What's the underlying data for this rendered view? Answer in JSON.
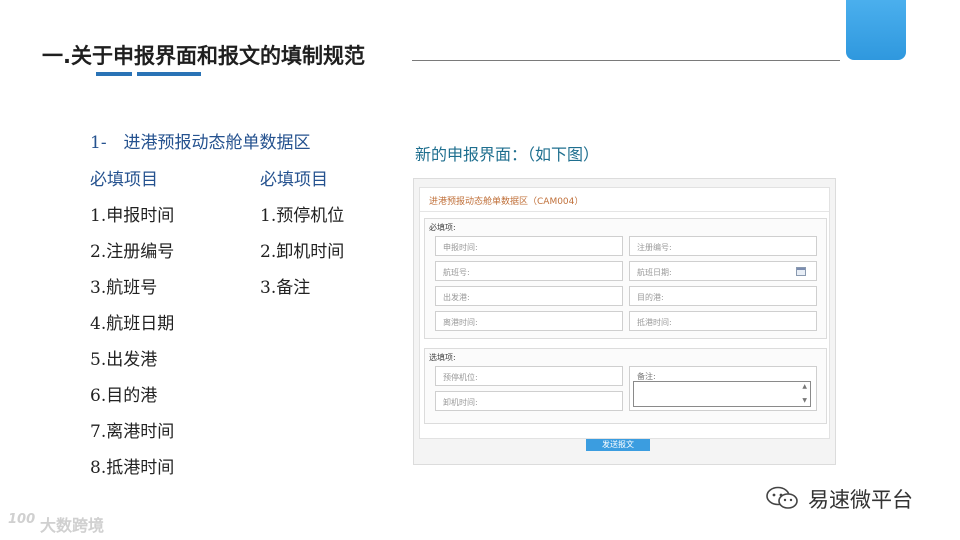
{
  "slide": {
    "title": "一.关于申报界面和报文的填制规范",
    "accent_color": "#2a73b6"
  },
  "left": {
    "section_heading": "1-　进港预报动态舱单数据区",
    "col1_heading": "必填项目",
    "col2_heading": "必填项目",
    "col1_items": [
      "1.申报时间",
      "2.注册编号",
      "3.航班号",
      "4.航班日期",
      "5.出发港",
      "6.目的港",
      "7.离港时间",
      "8.抵港时间"
    ],
    "col2_items": [
      "1.预停机位",
      "2.卸机时间",
      "3.备注"
    ]
  },
  "right": {
    "caption": "新的申报界面：（如下图）"
  },
  "form": {
    "header": "进港预报动态舱单数据区（CAM004）",
    "required_legend": "必填项:",
    "optional_legend": "选填项:",
    "fields": {
      "declare_time": "申报时间:",
      "reg_no": "注册编号:",
      "flight_no": "航班号:",
      "flight_date": "航班日期:",
      "origin": "出发港:",
      "destination": "目的港:",
      "departure_time": "离港时间:",
      "arrival_time": "抵港时间:",
      "parking_stand": "预停机位:",
      "unload_time": "卸机时间:",
      "remark": "备注:"
    },
    "send_button": "发送报文",
    "icons": {
      "calendar": "calendar-icon",
      "spinner": "spinner-arrows-icon"
    }
  },
  "footer": {
    "brand_right": "易速微平台",
    "brand_left": "大数跨境",
    "brand_left_logo": "100",
    "icon": "wechat-icon"
  }
}
